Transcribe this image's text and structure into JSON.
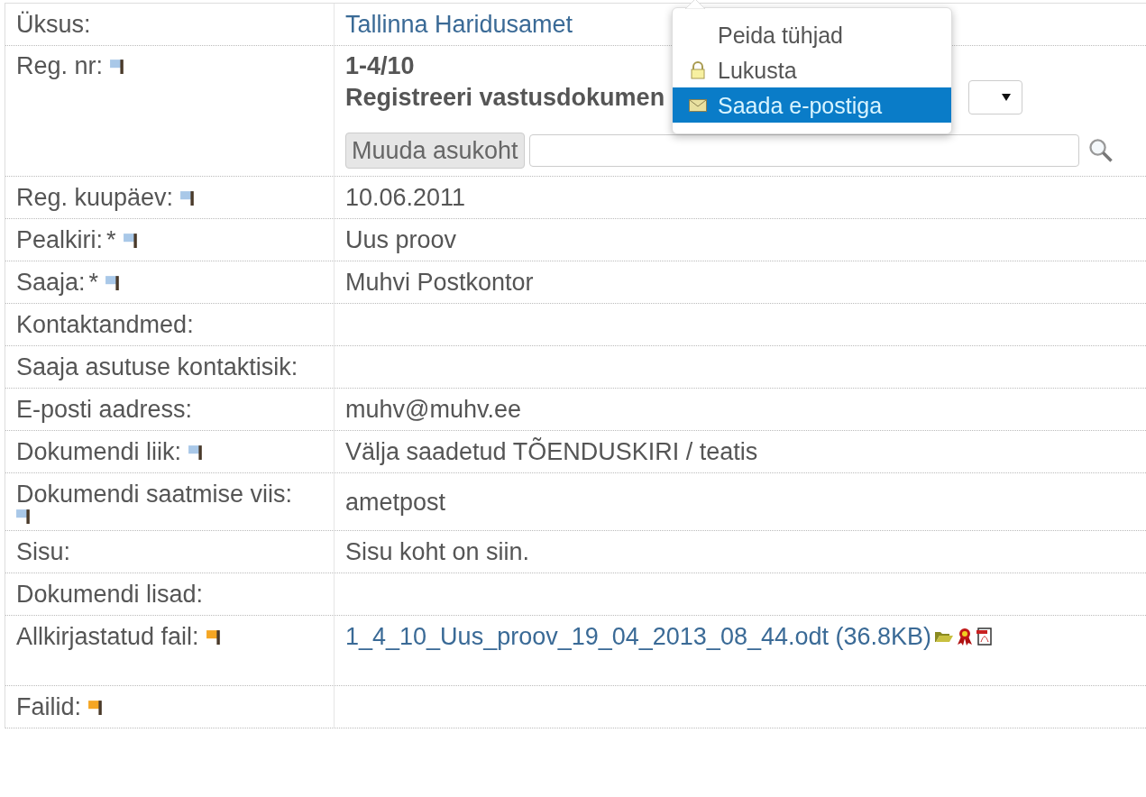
{
  "rows": [
    {
      "label": "Üksus:",
      "value": {
        "kind": "link",
        "text": "Tallinna Haridusamet"
      }
    },
    {
      "label": "Reg. nr:",
      "flag": {
        "color": "#a9c8e8"
      },
      "value": {
        "kind": "register",
        "number": "1-4/10",
        "action": "Registreeri vastusdokumen",
        "button": "Muuda asukoht"
      }
    },
    {
      "label": "Reg. kuupäev:",
      "flag": {
        "color": "#a9c8e8"
      },
      "value": {
        "kind": "text",
        "text": "10.06.2011"
      }
    },
    {
      "label": "Pealkiri:",
      "required": "*",
      "flag": {
        "color": "#a9c8e8"
      },
      "value": {
        "kind": "text",
        "text": "Uus proov"
      }
    },
    {
      "label": "Saaja:",
      "required": "*",
      "flag": {
        "color": "#a9c8e8"
      },
      "value": {
        "kind": "text",
        "text": "Muhvi Postkontor"
      }
    },
    {
      "label": "Kontaktandmed:"
    },
    {
      "label": "Saaja asutuse kontaktisik:"
    },
    {
      "label": "E-posti aadress:",
      "value": {
        "kind": "text",
        "text": "muhv@muhv.ee"
      }
    },
    {
      "label": "Dokumendi liik:",
      "flag": {
        "color": "#a9c8e8"
      },
      "value": {
        "kind": "text",
        "text": "Välja saadetud TÕENDUSKIRI / teatis"
      }
    },
    {
      "label": "Dokumendi saatmise viis:",
      "flag_below": true,
      "flag": {
        "color": "#a9c8e8"
      },
      "value": {
        "kind": "text",
        "text": "ametpost"
      }
    },
    {
      "label": "Sisu:",
      "value": {
        "kind": "text",
        "text": "Sisu koht on siin."
      }
    },
    {
      "label": "Dokumendi lisad:"
    },
    {
      "label": "Allkirjastatud fail:",
      "flag": {
        "color": "#f5a623"
      },
      "value": {
        "kind": "file",
        "text": "1_4_10_Uus_proov_19_04_2013_08_44.odt (36.8KB)"
      }
    },
    {
      "label": "Failid:",
      "flag": {
        "color": "#f5a623"
      }
    }
  ],
  "menu": {
    "items": [
      {
        "label": "Peida tühjad",
        "kind": "plain",
        "selected": false
      },
      {
        "label": "Lukusta",
        "kind": "lock",
        "selected": false
      },
      {
        "label": "Saada e-postiga",
        "kind": "mail",
        "selected": true
      }
    ]
  }
}
